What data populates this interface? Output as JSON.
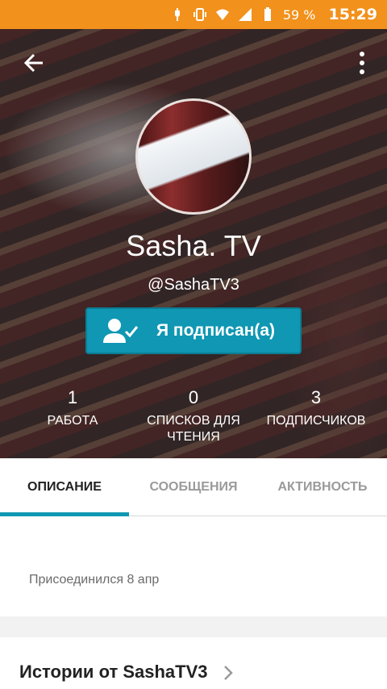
{
  "status_bar": {
    "battery_percent": "59 %",
    "time": "15:29"
  },
  "profile": {
    "name": "Sasha. TV",
    "handle": "@SashaTV3",
    "follow_label": "Я подписан(а)"
  },
  "stats": [
    {
      "value": "1",
      "label": "РАБОТА"
    },
    {
      "value": "0",
      "label": "СПИСКОВ ДЛЯ ЧТЕНИЯ"
    },
    {
      "value": "3",
      "label": "ПОДПИСЧИКОВ"
    }
  ],
  "tabs": [
    {
      "label": "ОПИСАНИЕ",
      "active": true
    },
    {
      "label": "СООБЩЕНИЯ",
      "active": false
    },
    {
      "label": "АКТИВНОСТЬ",
      "active": false
    }
  ],
  "description": {
    "joined": "Присоединился 8 апр"
  },
  "stories": {
    "title": "Истории от SashaTV3"
  },
  "colors": {
    "status_bar": "#f2911b",
    "accent": "#0f97b3"
  }
}
